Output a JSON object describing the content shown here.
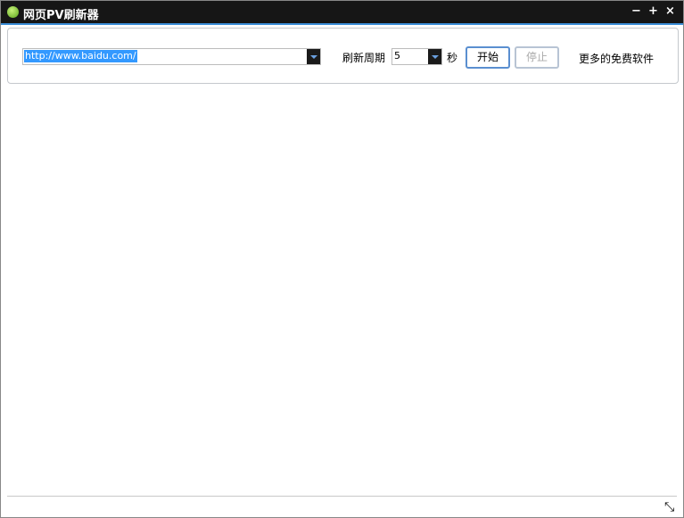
{
  "window": {
    "title": "网页PV刷新器",
    "minimize": "−",
    "maximize": "+",
    "close": "×"
  },
  "toolbar": {
    "url": "http://www.baidu.com/",
    "period_label": "刷新周期",
    "period_value": "5",
    "unit": "秒",
    "start": "开始",
    "stop": "停止",
    "more": "更多的免费软件"
  },
  "status": {
    "resize": "⤡"
  }
}
